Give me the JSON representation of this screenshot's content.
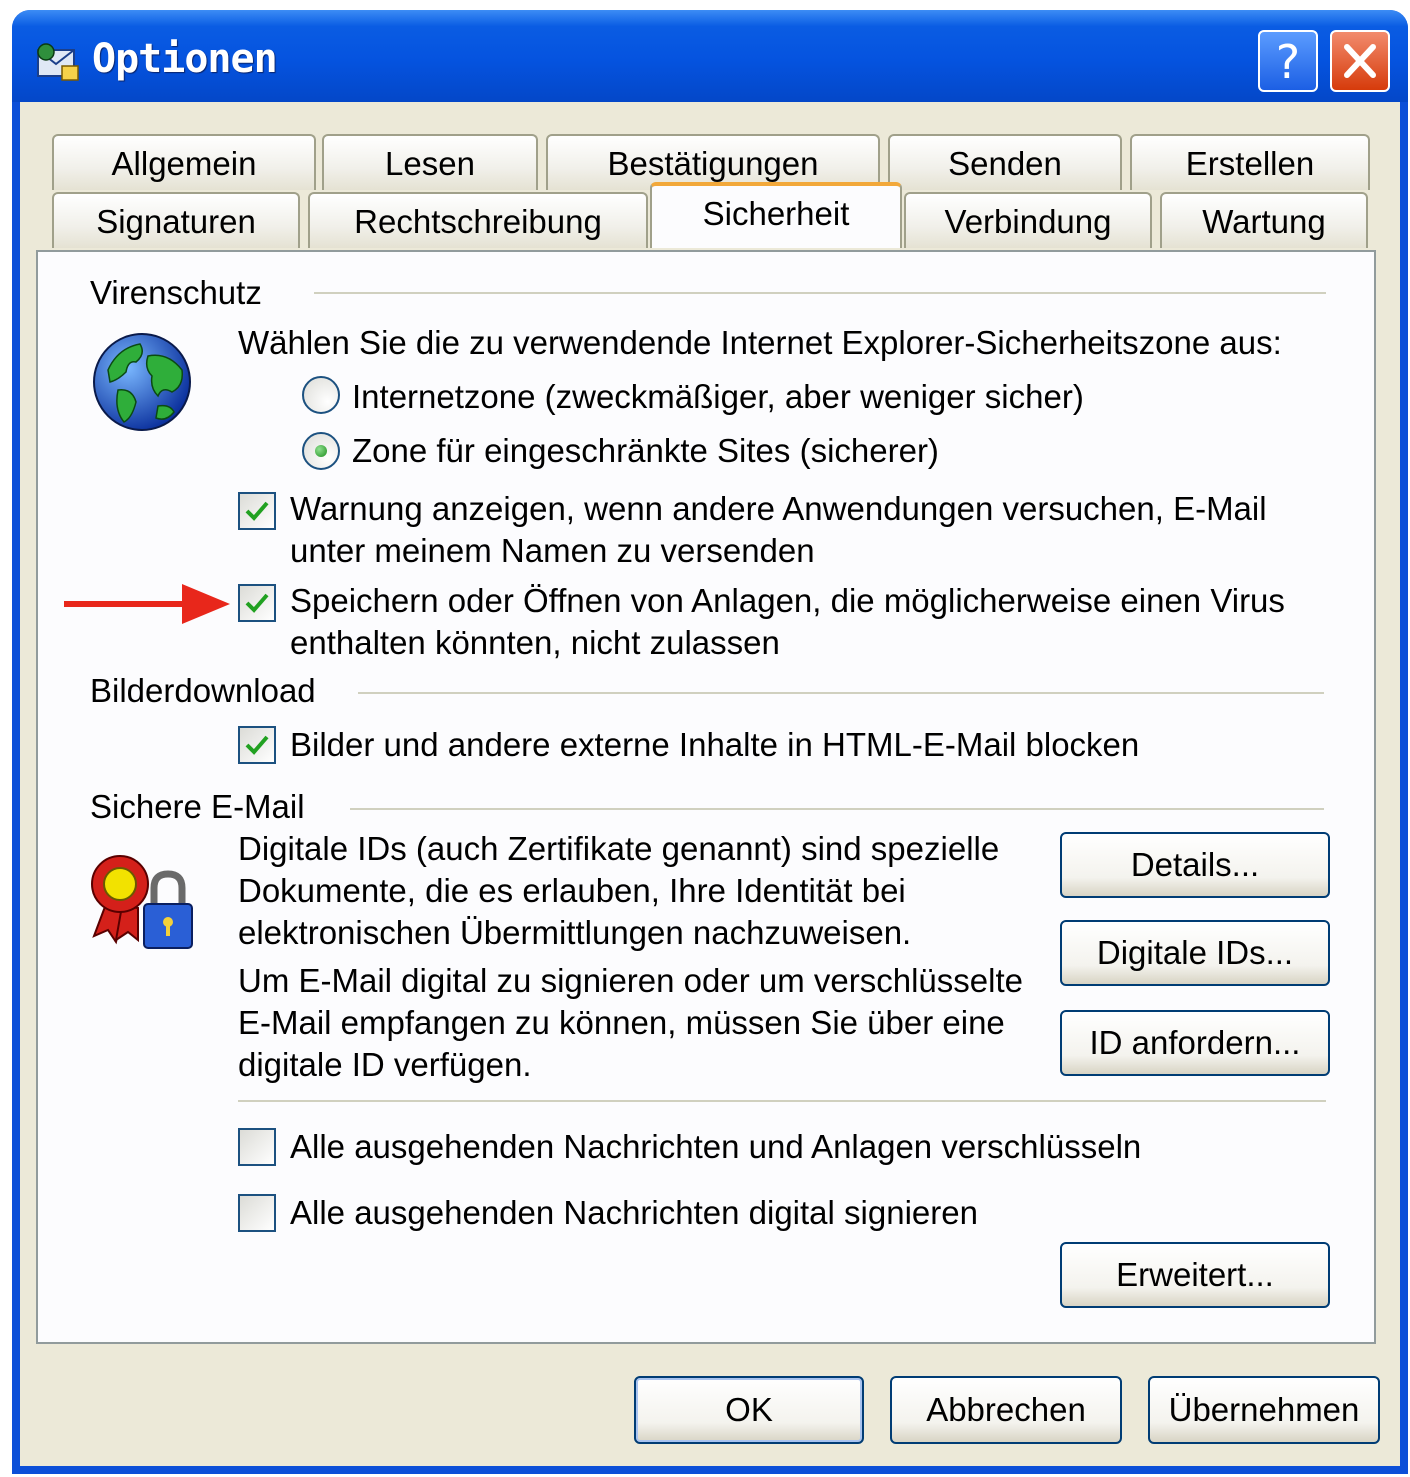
{
  "window": {
    "title": "Optionen",
    "help_button": "?",
    "colors": {
      "titlebar": "#0553df",
      "client": "#ece9d8",
      "panel": "#fcfcfe",
      "close": "#d63b0b",
      "active_tab_accent": "#f2a83a"
    }
  },
  "tabs": {
    "row1": [
      "Allgemein",
      "Lesen",
      "Bestätigungen",
      "Senden",
      "Erstellen"
    ],
    "row2": [
      "Signaturen",
      "Rechtschreibung",
      "Sicherheit",
      "Verbindung",
      "Wartung"
    ],
    "active": "Sicherheit"
  },
  "virenschutz": {
    "heading": "Virenschutz",
    "prompt": "Wählen Sie die zu verwendende Internet Explorer-Sicherheitszone aus:",
    "radio_internet": {
      "label": "Internetzone (zweckmäßiger, aber weniger sicher)",
      "selected": false
    },
    "radio_restricted": {
      "label": "Zone für eingeschränkte Sites (sicherer)",
      "selected": true
    },
    "warn_checkbox": {
      "line1": "Warnung anzeigen, wenn andere Anwendungen versuchen, E-Mail",
      "line2": "unter meinem Namen zu versenden",
      "checked": true
    },
    "attach_checkbox": {
      "line1": "Speichern oder Öffnen von Anlagen, die möglicherweise einen Virus",
      "line2": "enthalten könnten, nicht zulassen",
      "checked": true
    },
    "icon": "globe-icon"
  },
  "bilderdownload": {
    "heading": "Bilderdownload",
    "block_checkbox": {
      "label": "Bilder und andere externe Inhalte in HTML-E-Mail blocken",
      "checked": true
    }
  },
  "sichere_email": {
    "heading": "Sichere E-Mail",
    "icon": "certificate-lock-icon",
    "para1": [
      "Digitale IDs (auch Zertifikate genannt) sind spezielle",
      "Dokumente, die es erlauben, Ihre Identität bei",
      "elektronischen Übermittlungen nachzuweisen."
    ],
    "para2": [
      "Um E-Mail digital zu signieren oder um verschlüsselte",
      "E-Mail empfangen zu können, müssen Sie über eine",
      "digitale ID verfügen."
    ],
    "details_button": "Details...",
    "digital_ids_button": "Digitale IDs...",
    "request_id_button": "ID anfordern...",
    "encrypt_checkbox": {
      "label": "Alle ausgehenden Nachrichten und Anlagen verschlüsseln",
      "checked": false
    },
    "sign_checkbox": {
      "label": "Alle ausgehenden Nachrichten digital signieren",
      "checked": false
    },
    "advanced_button": "Erweitert..."
  },
  "footer": {
    "ok": "OK",
    "cancel": "Abbrechen",
    "apply": "Übernehmen"
  },
  "annotation": {
    "icon": "red-arrow-icon",
    "color": "#e8271b"
  }
}
